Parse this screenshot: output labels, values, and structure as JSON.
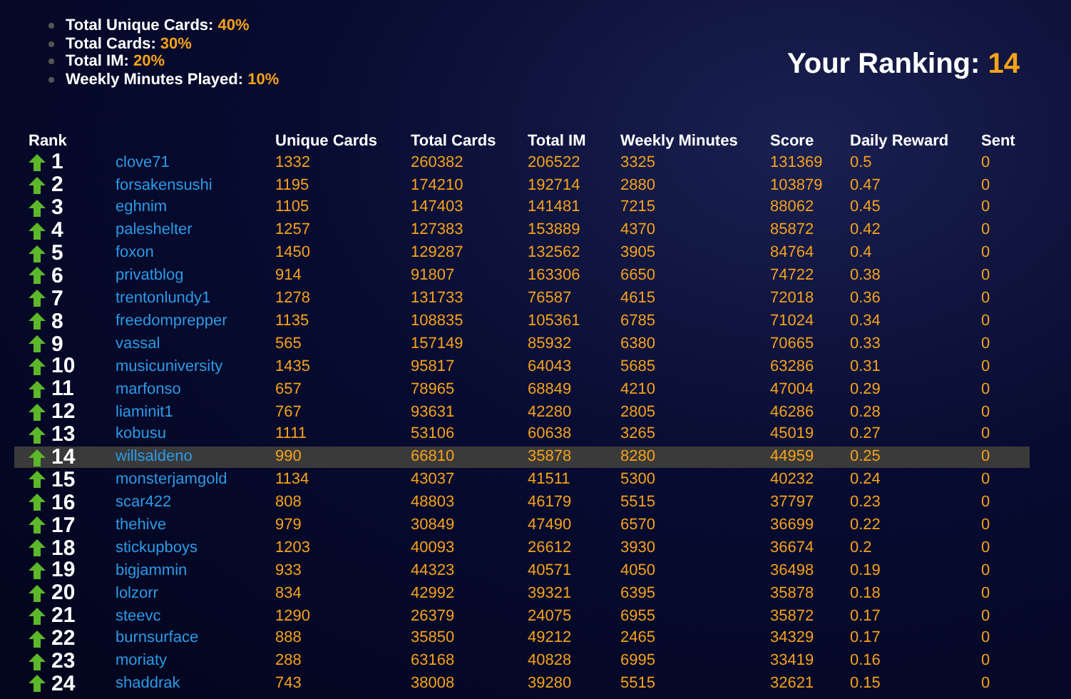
{
  "weights": [
    {
      "label": "Total Unique Cards:",
      "value": "40%"
    },
    {
      "label": "Total Cards:",
      "value": "30%"
    },
    {
      "label": "Total IM:",
      "value": "20%"
    },
    {
      "label": "Weekly Minutes Played:",
      "value": "10%"
    }
  ],
  "ranking": {
    "label": "Your Ranking:",
    "value": "14"
  },
  "table": {
    "columns": [
      "Rank",
      "",
      "Unique Cards",
      "Total Cards",
      "Total IM",
      "Weekly Minutes",
      "Score",
      "Daily Reward",
      "Sent"
    ],
    "rows": [
      {
        "kind": "up",
        "selected": false,
        "cells": [
          "1",
          "clove71",
          "1332",
          "260382",
          "206522",
          "3325",
          "131369",
          "0.5",
          "0"
        ]
      },
      {
        "kind": "up",
        "selected": false,
        "cells": [
          "2",
          "forsakensushi",
          "1195",
          "174210",
          "192714",
          "2880",
          "103879",
          "0.47",
          "0"
        ]
      },
      {
        "kind": "up",
        "selected": false,
        "cells": [
          "3",
          "eghnim",
          "1105",
          "147403",
          "141481",
          "7215",
          "88062",
          "0.45",
          "0"
        ]
      },
      {
        "kind": "up",
        "selected": false,
        "cells": [
          "4",
          "paleshelter",
          "1257",
          "127383",
          "153889",
          "4370",
          "85872",
          "0.42",
          "0"
        ]
      },
      {
        "kind": "up",
        "selected": false,
        "cells": [
          "5",
          "foxon",
          "1450",
          "129287",
          "132562",
          "3905",
          "84764",
          "0.4",
          "0"
        ]
      },
      {
        "kind": "up",
        "selected": false,
        "cells": [
          "6",
          "privatblog",
          "914",
          "91807",
          "163306",
          "6650",
          "74722",
          "0.38",
          "0"
        ]
      },
      {
        "kind": "up",
        "selected": false,
        "cells": [
          "7",
          "trentonlundy1",
          "1278",
          "131733",
          "76587",
          "4615",
          "72018",
          "0.36",
          "0"
        ]
      },
      {
        "kind": "up",
        "selected": false,
        "cells": [
          "8",
          "freedomprepper",
          "1135",
          "108835",
          "105361",
          "6785",
          "71024",
          "0.34",
          "0"
        ]
      },
      {
        "kind": "up",
        "selected": false,
        "cells": [
          "9",
          "vassal",
          "565",
          "157149",
          "85932",
          "6380",
          "70665",
          "0.33",
          "0"
        ]
      },
      {
        "kind": "up",
        "selected": false,
        "cells": [
          "10",
          "musicuniversity",
          "1435",
          "95817",
          "64043",
          "5685",
          "63286",
          "0.31",
          "0"
        ]
      },
      {
        "kind": "up",
        "selected": false,
        "cells": [
          "11",
          "marfonso",
          "657",
          "78965",
          "68849",
          "4210",
          "47004",
          "0.29",
          "0"
        ]
      },
      {
        "kind": "up",
        "selected": false,
        "cells": [
          "12",
          "liaminit1",
          "767",
          "93631",
          "42280",
          "2805",
          "46286",
          "0.28",
          "0"
        ]
      },
      {
        "kind": "up",
        "selected": false,
        "cells": [
          "13",
          "kobusu",
          "1111",
          "53106",
          "60638",
          "3265",
          "45019",
          "0.27",
          "0"
        ]
      },
      {
        "kind": "up",
        "selected": true,
        "cells": [
          "14",
          "willsaldeno",
          "990",
          "66810",
          "35878",
          "8280",
          "44959",
          "0.25",
          "0"
        ]
      },
      {
        "kind": "up",
        "selected": false,
        "cells": [
          "15",
          "monsterjamgold",
          "1134",
          "43037",
          "41511",
          "5300",
          "40232",
          "0.24",
          "0"
        ]
      },
      {
        "kind": "up",
        "selected": false,
        "cells": [
          "16",
          "scar422",
          "808",
          "48803",
          "46179",
          "5515",
          "37797",
          "0.23",
          "0"
        ]
      },
      {
        "kind": "up",
        "selected": false,
        "cells": [
          "17",
          "thehive",
          "979",
          "30849",
          "47490",
          "6570",
          "36699",
          "0.22",
          "0"
        ]
      },
      {
        "kind": "up",
        "selected": false,
        "cells": [
          "18",
          "stickupboys",
          "1203",
          "40093",
          "26612",
          "3930",
          "36674",
          "0.2",
          "0"
        ]
      },
      {
        "kind": "up",
        "selected": false,
        "cells": [
          "19",
          "bigjammin",
          "933",
          "44323",
          "40571",
          "4050",
          "36498",
          "0.19",
          "0"
        ]
      },
      {
        "kind": "up",
        "selected": false,
        "cells": [
          "20",
          "lolzorr",
          "834",
          "42992",
          "39321",
          "6395",
          "35878",
          "0.18",
          "0"
        ]
      },
      {
        "kind": "up",
        "selected": false,
        "cells": [
          "21",
          "steevc",
          "1290",
          "26379",
          "24075",
          "6955",
          "35872",
          "0.17",
          "0"
        ]
      },
      {
        "kind": "up",
        "selected": false,
        "cells": [
          "22",
          "burnsurface",
          "888",
          "35850",
          "49212",
          "2465",
          "34329",
          "0.17",
          "0"
        ]
      },
      {
        "kind": "up",
        "selected": false,
        "cells": [
          "23",
          "moriaty",
          "288",
          "63168",
          "40828",
          "6995",
          "33419",
          "0.16",
          "0"
        ]
      },
      {
        "kind": "up",
        "selected": false,
        "cells": [
          "24",
          "shaddrak",
          "743",
          "38008",
          "39280",
          "5515",
          "32621",
          "0.15",
          "0"
        ]
      }
    ]
  }
}
